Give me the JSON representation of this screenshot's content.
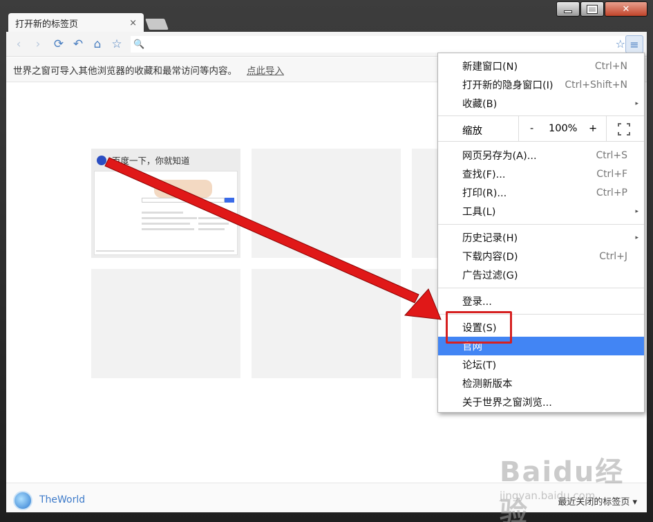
{
  "tab": {
    "title": "打开新的标签页",
    "close_glyph": "×"
  },
  "window_controls": {
    "close_glyph": "✕"
  },
  "toolbar": {
    "back_icon": "‹",
    "forward_icon": "›",
    "refresh_icon": "⟳",
    "undo_icon": "↶",
    "home_icon": "⌂",
    "star_icon": "☆",
    "search_glyph": "🔍",
    "menu_icon": "≡",
    "address_value": "",
    "address_placeholder": ""
  },
  "import_bar": {
    "text": "世界之窗可导入其他浏览器的收藏和最常访问等内容。",
    "link": "点此导入"
  },
  "tiles": {
    "baidu_title": "百度一下，你就知道"
  },
  "footer": {
    "brand": "TheWorld",
    "recent": "最近关闭的标签页 ▾"
  },
  "menu": {
    "new_window": {
      "label": "新建窗口(N)",
      "shortcut": "Ctrl+N"
    },
    "incognito": {
      "label": "打开新的隐身窗口(I)",
      "shortcut": "Ctrl+Shift+N"
    },
    "favorites": {
      "label": "收藏(B)",
      "arrow": "▸"
    },
    "zoom": {
      "label": "缩放",
      "minus": "-",
      "value": "100%",
      "plus": "+"
    },
    "save_as": {
      "label": "网页另存为(A)...",
      "shortcut": "Ctrl+S"
    },
    "find": {
      "label": "查找(F)...",
      "shortcut": "Ctrl+F"
    },
    "print": {
      "label": "打印(R)...",
      "shortcut": "Ctrl+P"
    },
    "tools": {
      "label": "工具(L)",
      "arrow": "▸"
    },
    "history": {
      "label": "历史记录(H)",
      "arrow": "▸"
    },
    "downloads": {
      "label": "下载内容(D)",
      "shortcut": "Ctrl+J"
    },
    "adblock": {
      "label": "广告过滤(G)"
    },
    "login": {
      "label": "登录..."
    },
    "settings": {
      "label": "设置(S)"
    },
    "website": {
      "label": "官网"
    },
    "forum": {
      "label": "论坛(T)"
    },
    "check_update": {
      "label": "检测新版本"
    },
    "about": {
      "label": "关于世界之窗浏览..."
    }
  },
  "watermark": {
    "main": "Baidu经验",
    "sub": "jingyan.baidu.com"
  },
  "colors": {
    "accent": "#4285f4",
    "annotation": "#d62020"
  }
}
